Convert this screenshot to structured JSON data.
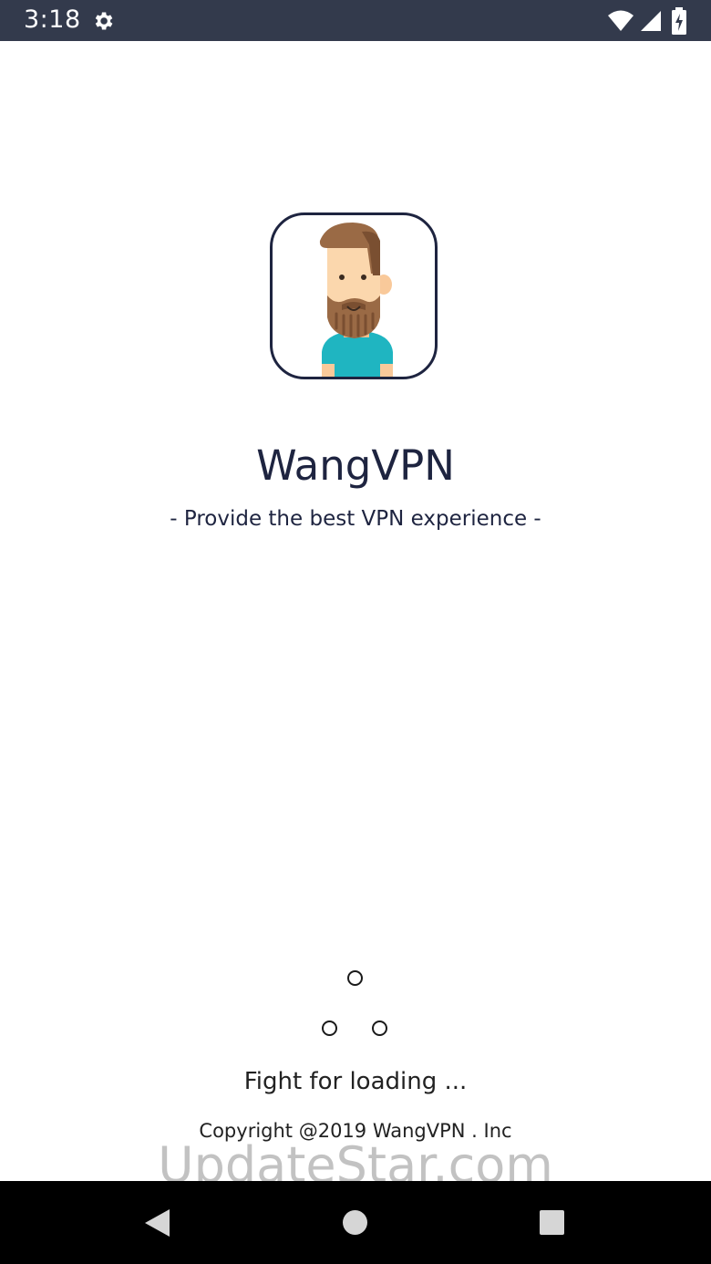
{
  "status_bar": {
    "time": "3:18",
    "icons": [
      "gear-icon",
      "wifi-icon",
      "cell-signal-icon",
      "battery-icon"
    ],
    "background": "#333a4c"
  },
  "splash": {
    "avatar_icon": "bearded-man-avatar",
    "title": "WangVPN",
    "tagline": "- Provide the best VPN experience -",
    "loading_text": "Fight for loading ...",
    "copyright": "Copyright @2019 WangVPN . Inc",
    "text_color": "#1e2440"
  },
  "watermark": {
    "text": "UpdateStar.com"
  },
  "nav_bar": {
    "buttons": [
      "back-icon",
      "home-icon",
      "recents-icon"
    ]
  }
}
